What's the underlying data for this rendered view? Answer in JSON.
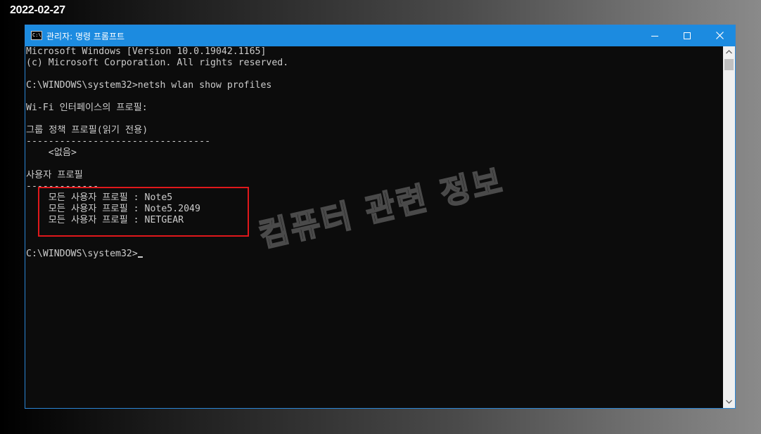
{
  "date_stamp": "2022-02-27",
  "window": {
    "title": "관리자: 명령 프롬프트",
    "icon": "cmd-icon",
    "app_icon_glyph": "C:\\"
  },
  "console": {
    "lines": [
      "Microsoft Windows [Version 10.0.19042.1165]",
      "(c) Microsoft Corporation. All rights reserved.",
      "",
      "C:\\WINDOWS\\system32>netsh wlan show profiles",
      "",
      "Wi-Fi 인터페이스의 프로필:",
      "",
      "그룹 정책 프로필(읽기 전용)",
      "---------------------------------",
      "    <없음>",
      "",
      "사용자 프로필",
      "-------------",
      "    모든 사용자 프로필 : Note5",
      "    모든 사용자 프로필 : Note5.2049",
      "    모든 사용자 프로필 : NETGEAR",
      "",
      "C:\\WINDOWS\\system32>"
    ]
  },
  "watermark": "컴퓨터 관련 정보",
  "colors": {
    "titlebar": "#1c8be0",
    "console_bg": "#0c0c0c",
    "console_text": "#cccccc",
    "highlight": "#e0181b"
  }
}
